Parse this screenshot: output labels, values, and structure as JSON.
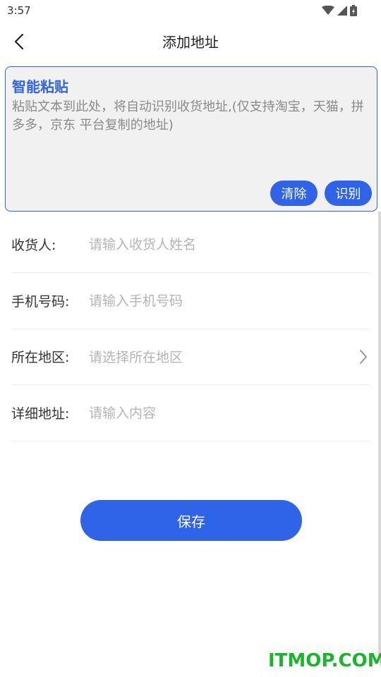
{
  "status_bar": {
    "time": "3:57"
  },
  "header": {
    "title": "添加地址"
  },
  "smart_paste": {
    "title": "智能粘贴",
    "hint": "粘贴文本到此处，将自动识别收货地址,(仅支持淘宝，天猫，拼多多，京东 平台复制的地址)",
    "clear_label": "清除",
    "recognize_label": "识别"
  },
  "form": {
    "recipient": {
      "label": "收货人:",
      "placeholder": "请输入收货人姓名"
    },
    "phone": {
      "label": "手机号码:",
      "placeholder": "请输入手机号码"
    },
    "region": {
      "label": "所在地区:",
      "placeholder": "请选择所在地区"
    },
    "detail": {
      "label": "详细地址:",
      "placeholder": "请输入内容"
    }
  },
  "actions": {
    "save_label": "保存"
  },
  "watermark": {
    "text": "ITMOP.COM"
  },
  "colors": {
    "accent": "#2f63e8",
    "watermark": "#19b52a"
  }
}
